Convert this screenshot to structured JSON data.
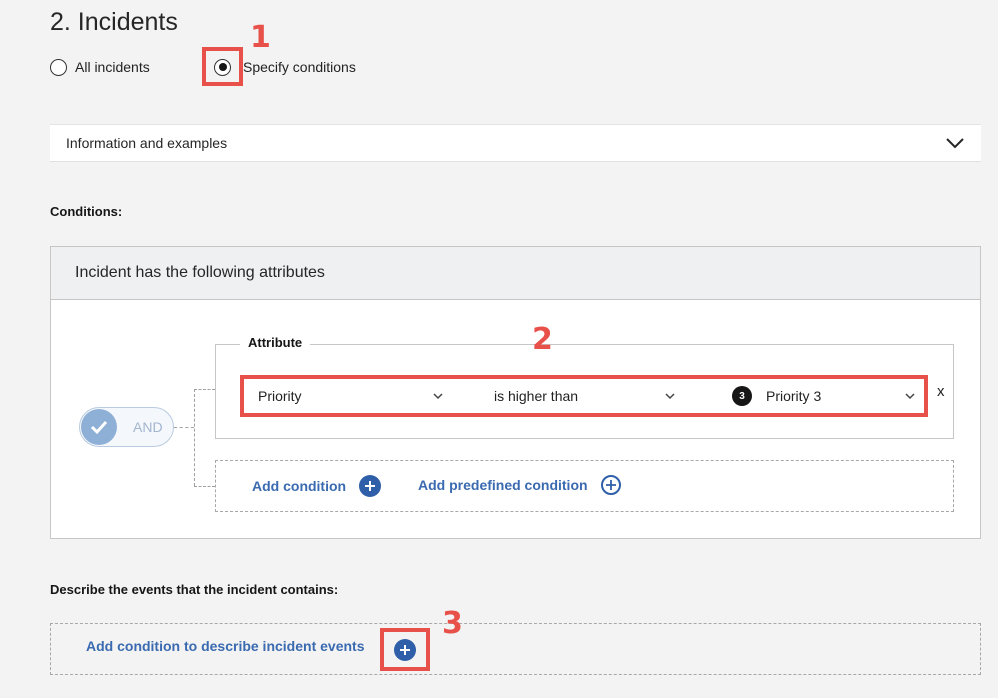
{
  "section": {
    "title": "2. Incidents"
  },
  "radios": [
    {
      "label": "All incidents",
      "checked": false
    },
    {
      "label": "Specify conditions",
      "checked": true
    }
  ],
  "callouts": [
    "1",
    "2",
    "3"
  ],
  "accordion": {
    "label": "Information and examples",
    "icon": "chevron-down-icon"
  },
  "conditions": {
    "label": "Conditions:",
    "panel_header": "Incident has the following attributes",
    "operator": "AND",
    "attribute_group": {
      "legend": "Attribute",
      "field": "Priority",
      "comparator": "is higher than",
      "value_badge": "3",
      "value": "Priority 3",
      "remove": "x"
    },
    "add_condition": "Add condition",
    "add_predefined_condition": "Add predefined condition"
  },
  "events": {
    "label": "Describe the events that the incident contains:",
    "add_label": "Add condition to describe incident events"
  },
  "colors": {
    "accent": "#2f5fa8",
    "callout": "#e8514a",
    "link": "#3a6ab0"
  }
}
